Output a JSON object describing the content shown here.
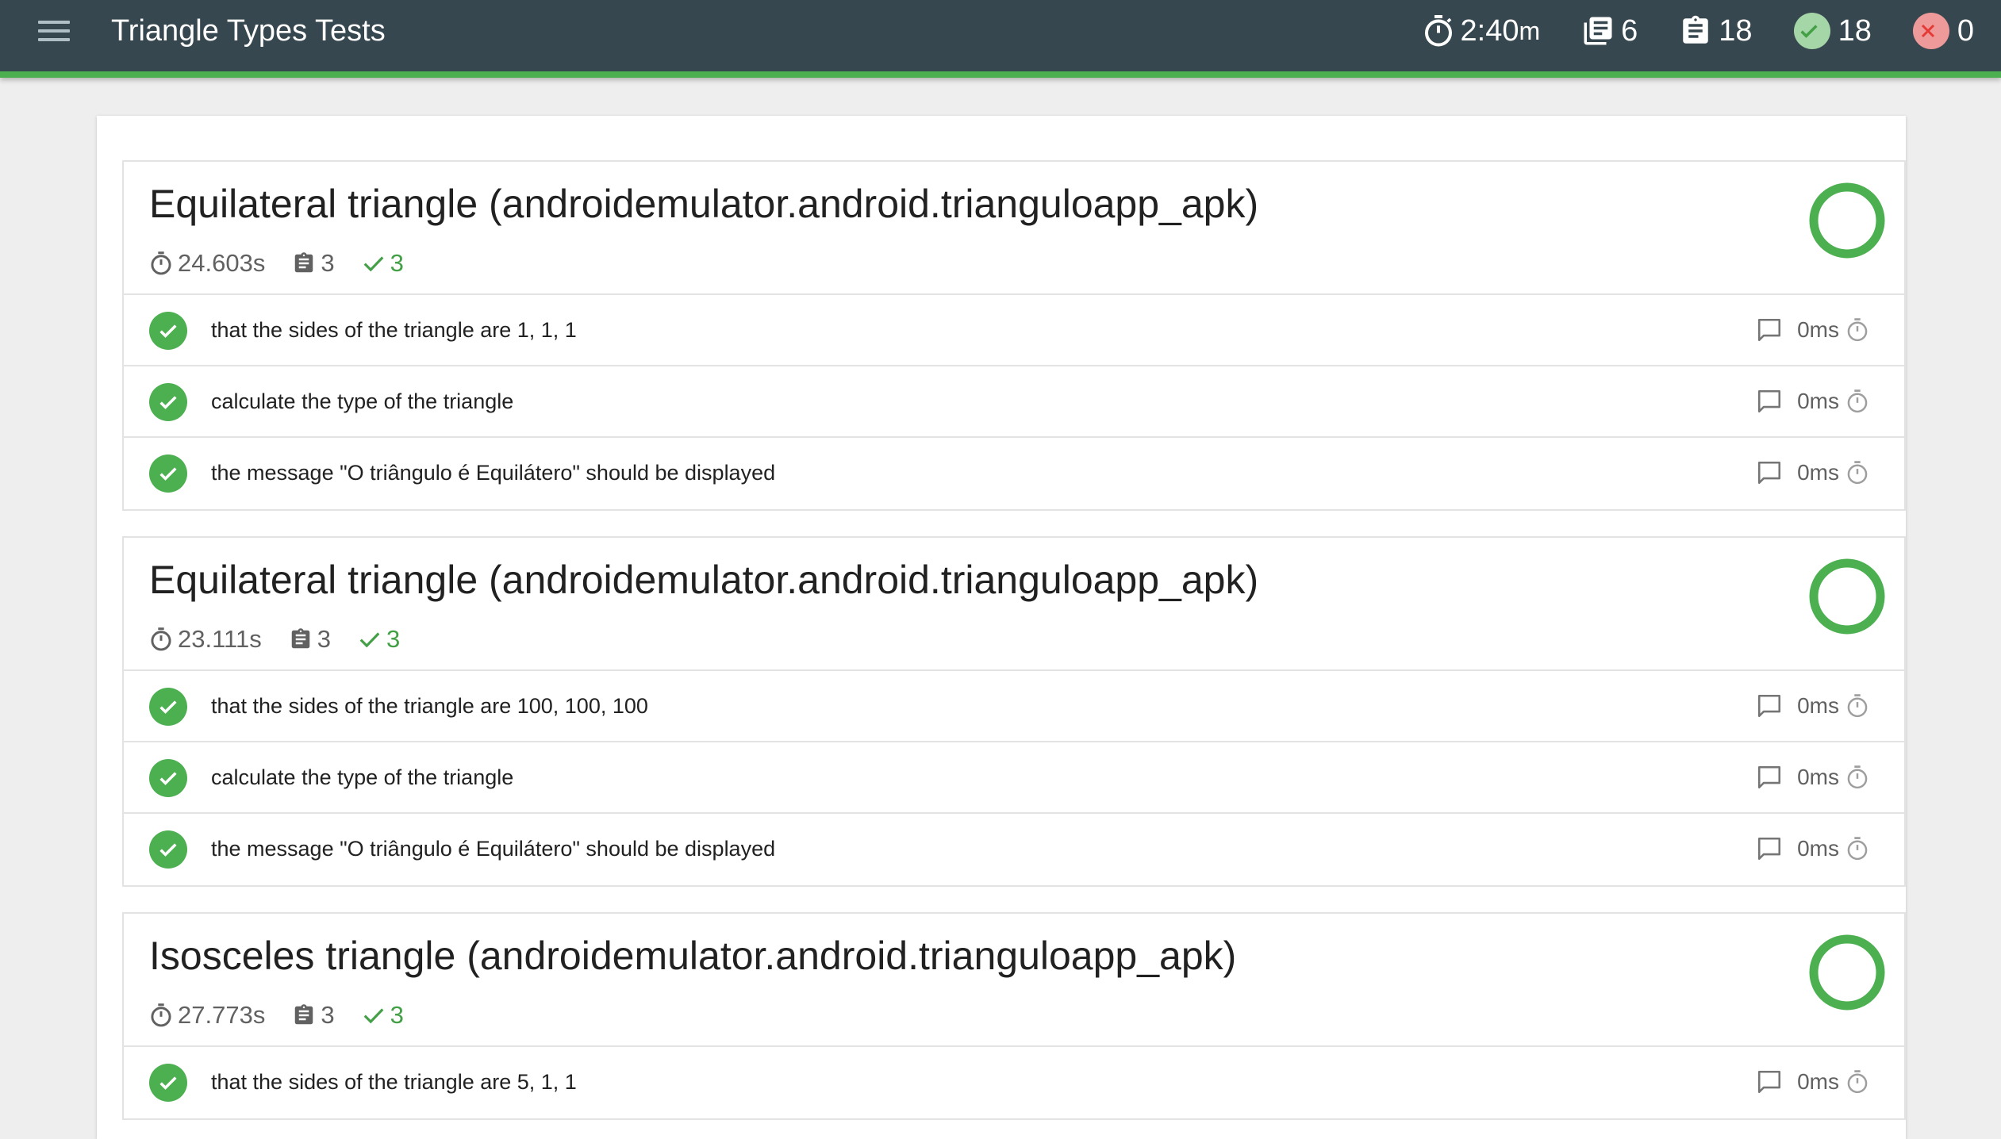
{
  "header": {
    "title": "Triangle Types Tests",
    "duration_value": "2:40",
    "duration_unit": "m",
    "features_count": "6",
    "scenarios_count": "18",
    "passed_count": "18",
    "failed_count": "0"
  },
  "colors": {
    "topbar": "#37474f",
    "accent_green": "#4caf50",
    "fail_red": "#f44336"
  },
  "features": [
    {
      "title": "Equilateral triangle (androidemulator.android.trianguloapp_apk)",
      "duration": "24.603s",
      "scenarios": "3",
      "passed": "3",
      "steps": [
        {
          "text": "that the sides of the triangle are 1, 1, 1",
          "duration": "0ms"
        },
        {
          "text": "calculate the type of the triangle",
          "duration": "0ms"
        },
        {
          "text": "the message \"O triângulo é Equilátero\" should be displayed",
          "duration": "0ms"
        }
      ]
    },
    {
      "title": "Equilateral triangle (androidemulator.android.trianguloapp_apk)",
      "duration": "23.111s",
      "scenarios": "3",
      "passed": "3",
      "steps": [
        {
          "text": "that the sides of the triangle are 100, 100, 100",
          "duration": "0ms"
        },
        {
          "text": "calculate the type of the triangle",
          "duration": "0ms"
        },
        {
          "text": "the message \"O triângulo é Equilátero\" should be displayed",
          "duration": "0ms"
        }
      ]
    },
    {
      "title": "Isosceles triangle (androidemulator.android.trianguloapp_apk)",
      "duration": "27.773s",
      "scenarios": "3",
      "passed": "3",
      "steps": [
        {
          "text": "that the sides of the triangle are 5, 1, 1",
          "duration": "0ms"
        }
      ]
    }
  ]
}
